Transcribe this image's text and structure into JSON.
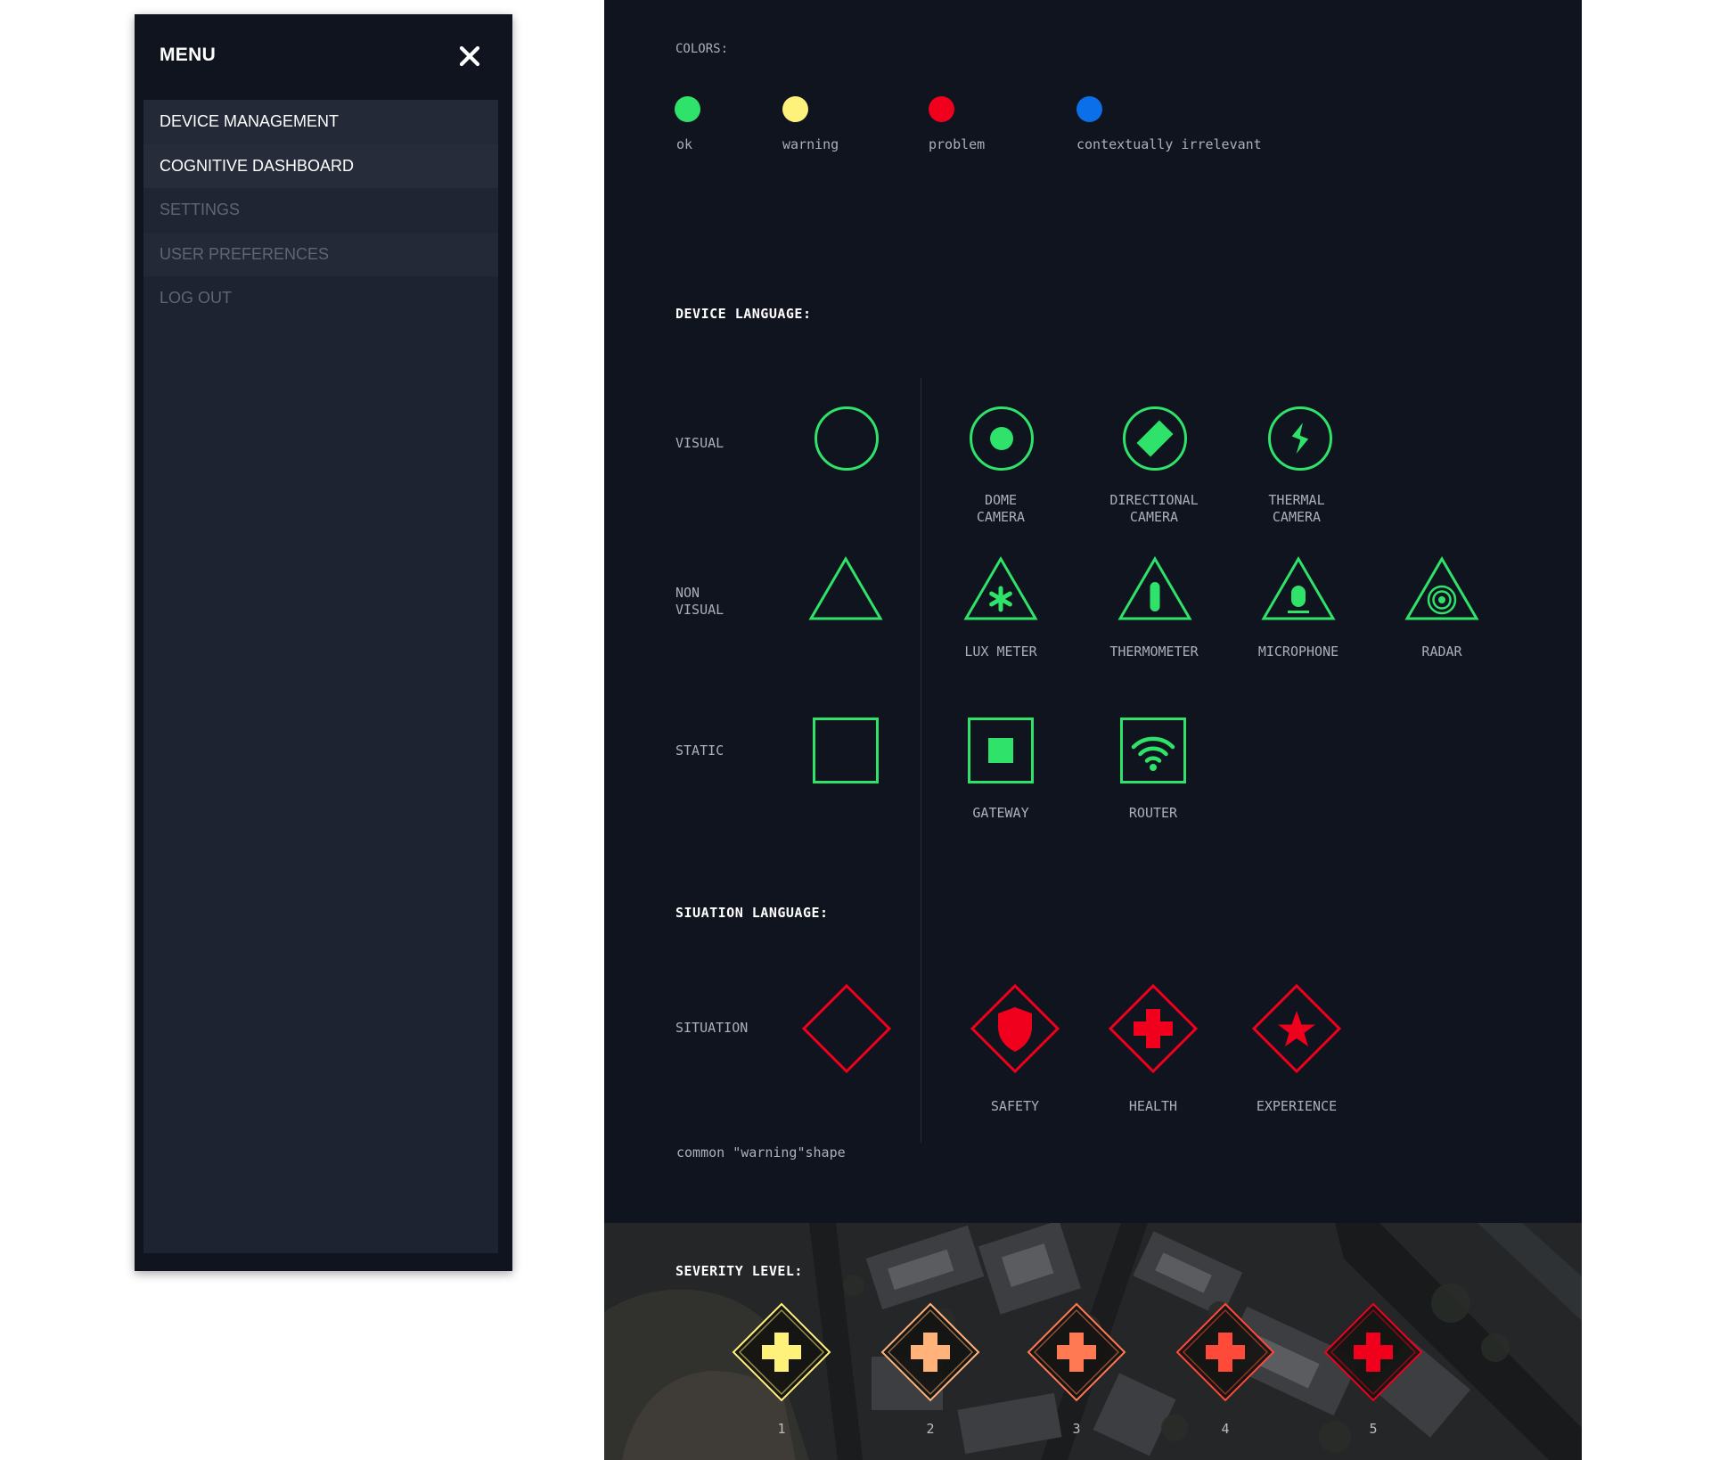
{
  "menu": {
    "title": "MENU",
    "items": [
      {
        "label": "DEVICE MANAGEMENT"
      },
      {
        "label": "COGNITIVE DASHBOARD"
      },
      {
        "label": "SETTINGS"
      },
      {
        "label": "USER PREFERENCES"
      },
      {
        "label": "LOG OUT"
      }
    ]
  },
  "colors_section": {
    "title": "COLORS:",
    "swatches": [
      {
        "label": "ok",
        "color": "#2fe26a"
      },
      {
        "label": "warning",
        "color": "#fff27a"
      },
      {
        "label": "problem",
        "color": "#f0001c"
      },
      {
        "label": "contextually irrelevant",
        "color": "#0a6fe8"
      }
    ]
  },
  "device_language": {
    "title": "DEVICE LANGUAGE:",
    "rows": {
      "visual": {
        "label": "VISUAL",
        "items": [
          {
            "line1": "DOME",
            "line2": "CAMERA",
            "icon": "dome-camera-icon"
          },
          {
            "line1": "DIRECTIONAL",
            "line2": "CAMERA",
            "icon": "directional-camera-icon"
          },
          {
            "line1": "THERMAL",
            "line2": "CAMERA",
            "icon": "thermal-camera-icon"
          }
        ]
      },
      "non_visual": {
        "line1": "NON",
        "line2": "VISUAL",
        "items": [
          {
            "label": "LUX METER",
            "icon": "lux-meter-icon"
          },
          {
            "label": "THERMOMETER",
            "icon": "thermometer-icon"
          },
          {
            "label": "MICROPHONE",
            "icon": "microphone-icon"
          },
          {
            "label": "RADAR",
            "icon": "radar-icon"
          }
        ]
      },
      "static": {
        "label": "STATIC",
        "items": [
          {
            "label": "GATEWAY",
            "icon": "gateway-icon"
          },
          {
            "label": "ROUTER",
            "icon": "router-icon"
          }
        ]
      }
    }
  },
  "situation_language": {
    "title": "SIUATION LANGUAGE:",
    "row_label": "SITUATION",
    "items": [
      {
        "label": "SAFETY",
        "icon": "shield-icon"
      },
      {
        "label": "HEALTH",
        "icon": "cross-icon"
      },
      {
        "label": "EXPERIENCE",
        "icon": "star-icon"
      }
    ],
    "note": "common \"warning\"shape"
  },
  "severity": {
    "title": "SEVERITY LEVEL:",
    "levels": [
      {
        "label": "1",
        "color": "#fff27a"
      },
      {
        "label": "2",
        "color": "#ffb27a"
      },
      {
        "label": "3",
        "color": "#ff7a52"
      },
      {
        "label": "4",
        "color": "#ff4a3a"
      },
      {
        "label": "5",
        "color": "#f0001c"
      }
    ]
  },
  "palette": {
    "panel_bg": "#10141e",
    "menu_bg": "#1d2330",
    "device_green": "#2fe26a",
    "situation_red": "#f0001c"
  }
}
